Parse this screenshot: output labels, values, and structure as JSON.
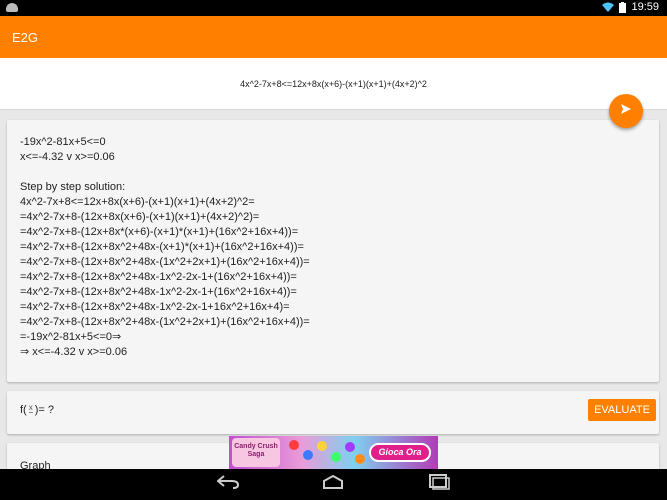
{
  "status_bar": {
    "time": "19:59",
    "icons": [
      "android-icon",
      "wifi-icon",
      "battery-icon"
    ]
  },
  "app_bar": {
    "title": "E2G"
  },
  "input": {
    "expression": "4x^2-7x+8<=12x+8x(x+6)-(x+1)(x+1)+(4x+2)^2"
  },
  "fab": {
    "icon": "send-icon"
  },
  "result": {
    "lines": [
      "-19x^2-81x+5<=0",
      "x<=-4.32 v x>=0.06",
      "",
      "Step by step solution:",
      "4x^2-7x+8<=12x+8x(x+6)-(x+1)(x+1)+(4x+2)^2=",
      "=4x^2-7x+8-(12x+8x(x+6)-(x+1)(x+1)+(4x+2)^2)=",
      "=4x^2-7x+8-(12x+8x*(x+6)-(x+1)*(x+1)+(16x^2+16x+4))=",
      "=4x^2-7x+8-(12x+8x^2+48x-(x+1)*(x+1)+(16x^2+16x+4))=",
      "=4x^2-7x+8-(12x+8x^2+48x-(1x^2+2x+1)+(16x^2+16x+4))=",
      "=4x^2-7x+8-(12x+8x^2+48x-1x^2-2x-1+(16x^2+16x+4))=",
      "=4x^2-7x+8-(12x+8x^2+48x-1x^2-2x-1+(16x^2+16x+4))=",
      "=4x^2-7x+8-(12x+8x^2+48x-1x^2-2x-1+16x^2+16x+4)=",
      "=4x^2-7x+8-(12x+8x^2+48x-(1x^2+2x+1)+(16x^2+16x+4))=",
      "=-19x^2-81x+5<=0⇒",
      "⇒ x<=-4.32 v x>=0.06"
    ]
  },
  "function": {
    "prefix": "f(",
    "variable": "x",
    "suffix": ")= ?",
    "evaluate_label": "EVALUATE"
  },
  "graph": {
    "label": "Graph"
  },
  "ad": {
    "logo_text": "Candy Crush Saga",
    "cta": "Gioca Ora"
  },
  "colors": {
    "accent": "#ff8000",
    "card": "#f5f5f5",
    "background": "#e8e8e8"
  }
}
